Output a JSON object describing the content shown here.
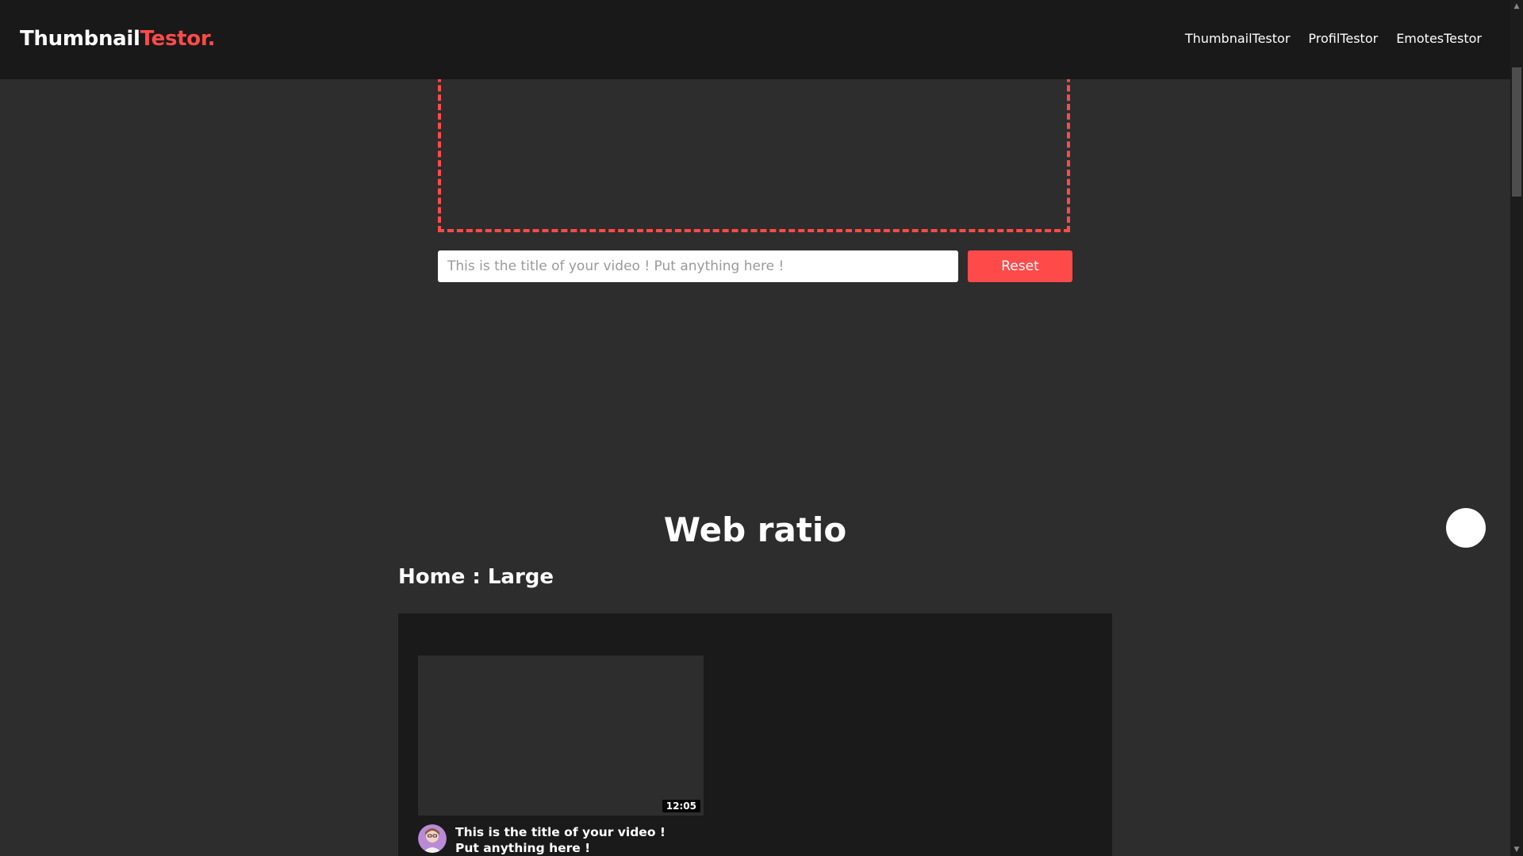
{
  "header": {
    "logo_main": "Thumbnail",
    "logo_accent": "Testor.",
    "nav": [
      "ThumbnailTestor",
      "ProfilTestor",
      "EmotesTestor"
    ]
  },
  "editor": {
    "title_placeholder": "This is the title of your video ! Put anything here !",
    "reset_label": "Reset"
  },
  "section": {
    "title": "Web ratio",
    "subtitle": "Home : Large"
  },
  "preview": {
    "duration": "12:05",
    "video_title": "This is the title of your video ! Put anything here !"
  },
  "colors": {
    "accent": "#ff4a4a",
    "background": "#2d2d2d",
    "topbar": "#191919",
    "panel": "#1a1a1a"
  },
  "icons": {
    "avatar": "channel-avatar-icon",
    "scroll_up": "chevron-up-icon",
    "scroll_down": "chevron-down-icon"
  }
}
